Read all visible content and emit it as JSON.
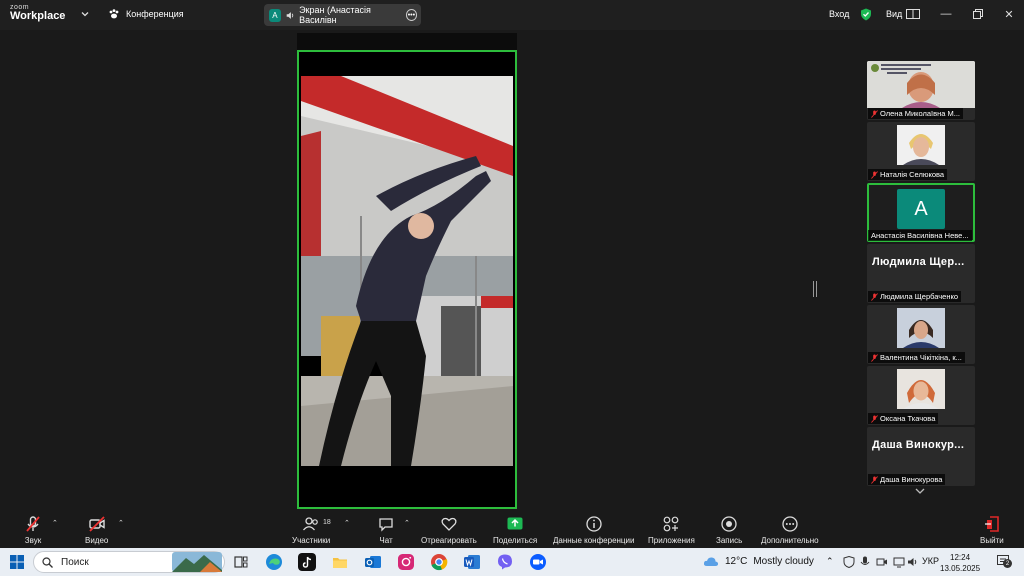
{
  "topbar": {
    "logo_line1": "zoom",
    "logo_line2": "Workplace",
    "meeting_label": "Конференция",
    "share_avatar": "A",
    "share_title": "Экран (Анастасія Василівн",
    "signin_label": "Вход",
    "view_label": "Вид"
  },
  "participants": [
    {
      "name": "Олена Миколаївна М...",
      "type": "photo-wide"
    },
    {
      "name": "Наталія Селюкова",
      "type": "photo"
    },
    {
      "name": "Анастасія Василівна Неве...",
      "type": "avatar",
      "initial": "A",
      "active": true
    },
    {
      "name": "Людмила Щербаченко",
      "big_name": "Людмила  Щер...",
      "type": "text"
    },
    {
      "name": "Валентина Чікіткіна, к...",
      "type": "photo"
    },
    {
      "name": "Оксана Ткачова",
      "type": "photo"
    },
    {
      "name": "Даша Винокурова",
      "big_name": "Даша  Винокур...",
      "type": "text"
    }
  ],
  "toolbar": {
    "audio": "Звук",
    "video": "Видео",
    "participants": "Участники",
    "participants_count": "18",
    "chat": "Чат",
    "react": "Отреагировать",
    "share": "Поделиться",
    "info": "Данные конференции",
    "apps": "Приложения",
    "record": "Запись",
    "more": "Дополнительно",
    "leave": "Выйти"
  },
  "taskbar": {
    "search_placeholder": "Поиск",
    "temperature": "12°C",
    "weather": "Mostly cloudy",
    "lang": "УКР",
    "time": "12:24",
    "date": "13.05.2025",
    "notif_count": "2"
  },
  "colors": {
    "active_border": "#2dbd3c",
    "share_green": "#1db954",
    "avatar_teal": "#0b8a7a",
    "leave_red": "#e02828"
  }
}
